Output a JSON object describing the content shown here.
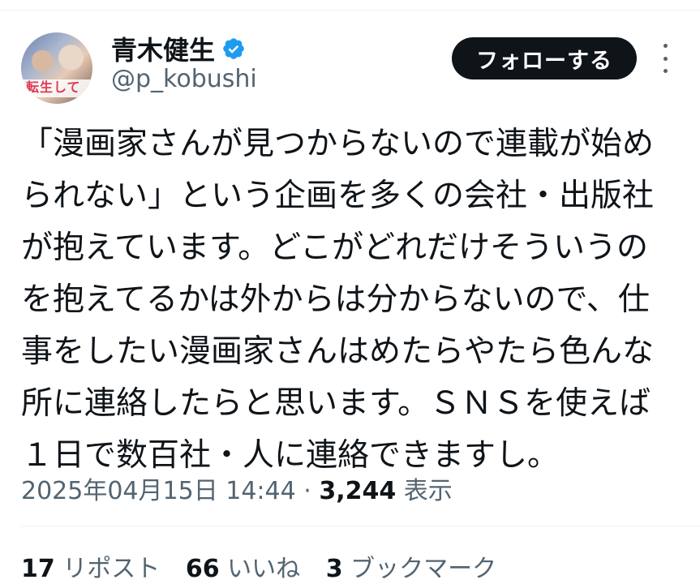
{
  "author": {
    "name": "青木健生",
    "handle": "@p_kobushi",
    "avatar_text": "転生して",
    "verified_color": "#1d9bf0"
  },
  "follow_button": {
    "label": "フォローする"
  },
  "more_icon": "more-vertical-icon",
  "tweet": {
    "lines": [
      "「漫画家さんが見つからないので連載が始め",
      "られない」という企画を多くの会社・出版社",
      "が抱えています。どこがどれだけそういうの",
      "を抱えてるかは外からは分からないので、仕",
      "事をしたい漫画家さんはめたらやたら色んな",
      "所に連絡したらと思います。ＳＮＳを使えば",
      "１日で数百社・人に連絡できますし。"
    ]
  },
  "meta": {
    "timestamp": "2025年04月15日 14:44",
    "separator": "·",
    "views_count": "3,244",
    "views_label": "表示"
  },
  "stats": {
    "reposts_count": "17",
    "reposts_label": "リポスト",
    "likes_count": "66",
    "likes_label": "いいね",
    "bookmarks_count": "3",
    "bookmarks_label": "ブックマーク"
  },
  "colors": {
    "text": "#0f1419",
    "secondary": "#536471",
    "button_bg": "#0f1419",
    "divider": "#eff3f4"
  }
}
